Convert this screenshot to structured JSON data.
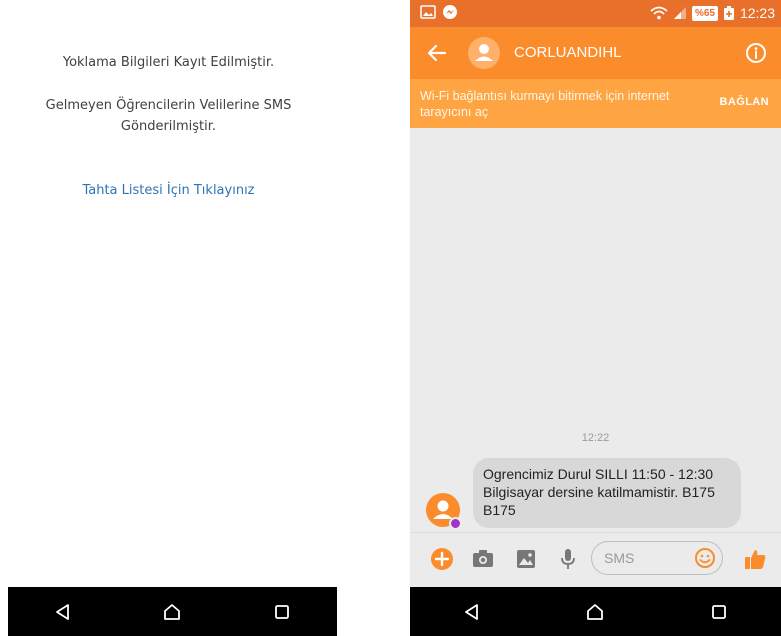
{
  "left_screen": {
    "line1": "Yoklama Bilgileri Kayıt Edilmiştir.",
    "line2": "Gelmeyen Öğrencilerin Velilerine SMS",
    "line3": "Gönderilmiştir.",
    "link_label": "Tahta Listesi İçin Tıklayınız"
  },
  "right_screen": {
    "status_bar": {
      "battery": "%65",
      "time": "12:23"
    },
    "app_bar": {
      "contact_name": "CORLUANDIHL"
    },
    "banner": {
      "text": "Wi-Fi bağlantısı kurmayı bitirmek için internet tarayıcını aç",
      "action": "BAĞLAN"
    },
    "conversation": {
      "timestamp": "12:22",
      "message": "Ogrencimiz  Durul SILLI 11:50 - 12:30 Bilgisayar dersine katilmamistir. B175 B175"
    },
    "composer": {
      "placeholder": "SMS"
    }
  },
  "icons": {
    "nav": [
      "back-triangle-icon",
      "home-outline-icon",
      "recents-square-icon"
    ],
    "composer": [
      "plus-icon",
      "camera-icon",
      "image-icon",
      "microphone-icon",
      "emoji-icon",
      "thumbs-up-icon"
    ]
  },
  "colors": {
    "status_bar": "#e8702a",
    "app_bar": "#fb8c2c",
    "banner": "#ffa443",
    "link": "#2e74b5",
    "bubble": "#d8d8d8"
  }
}
